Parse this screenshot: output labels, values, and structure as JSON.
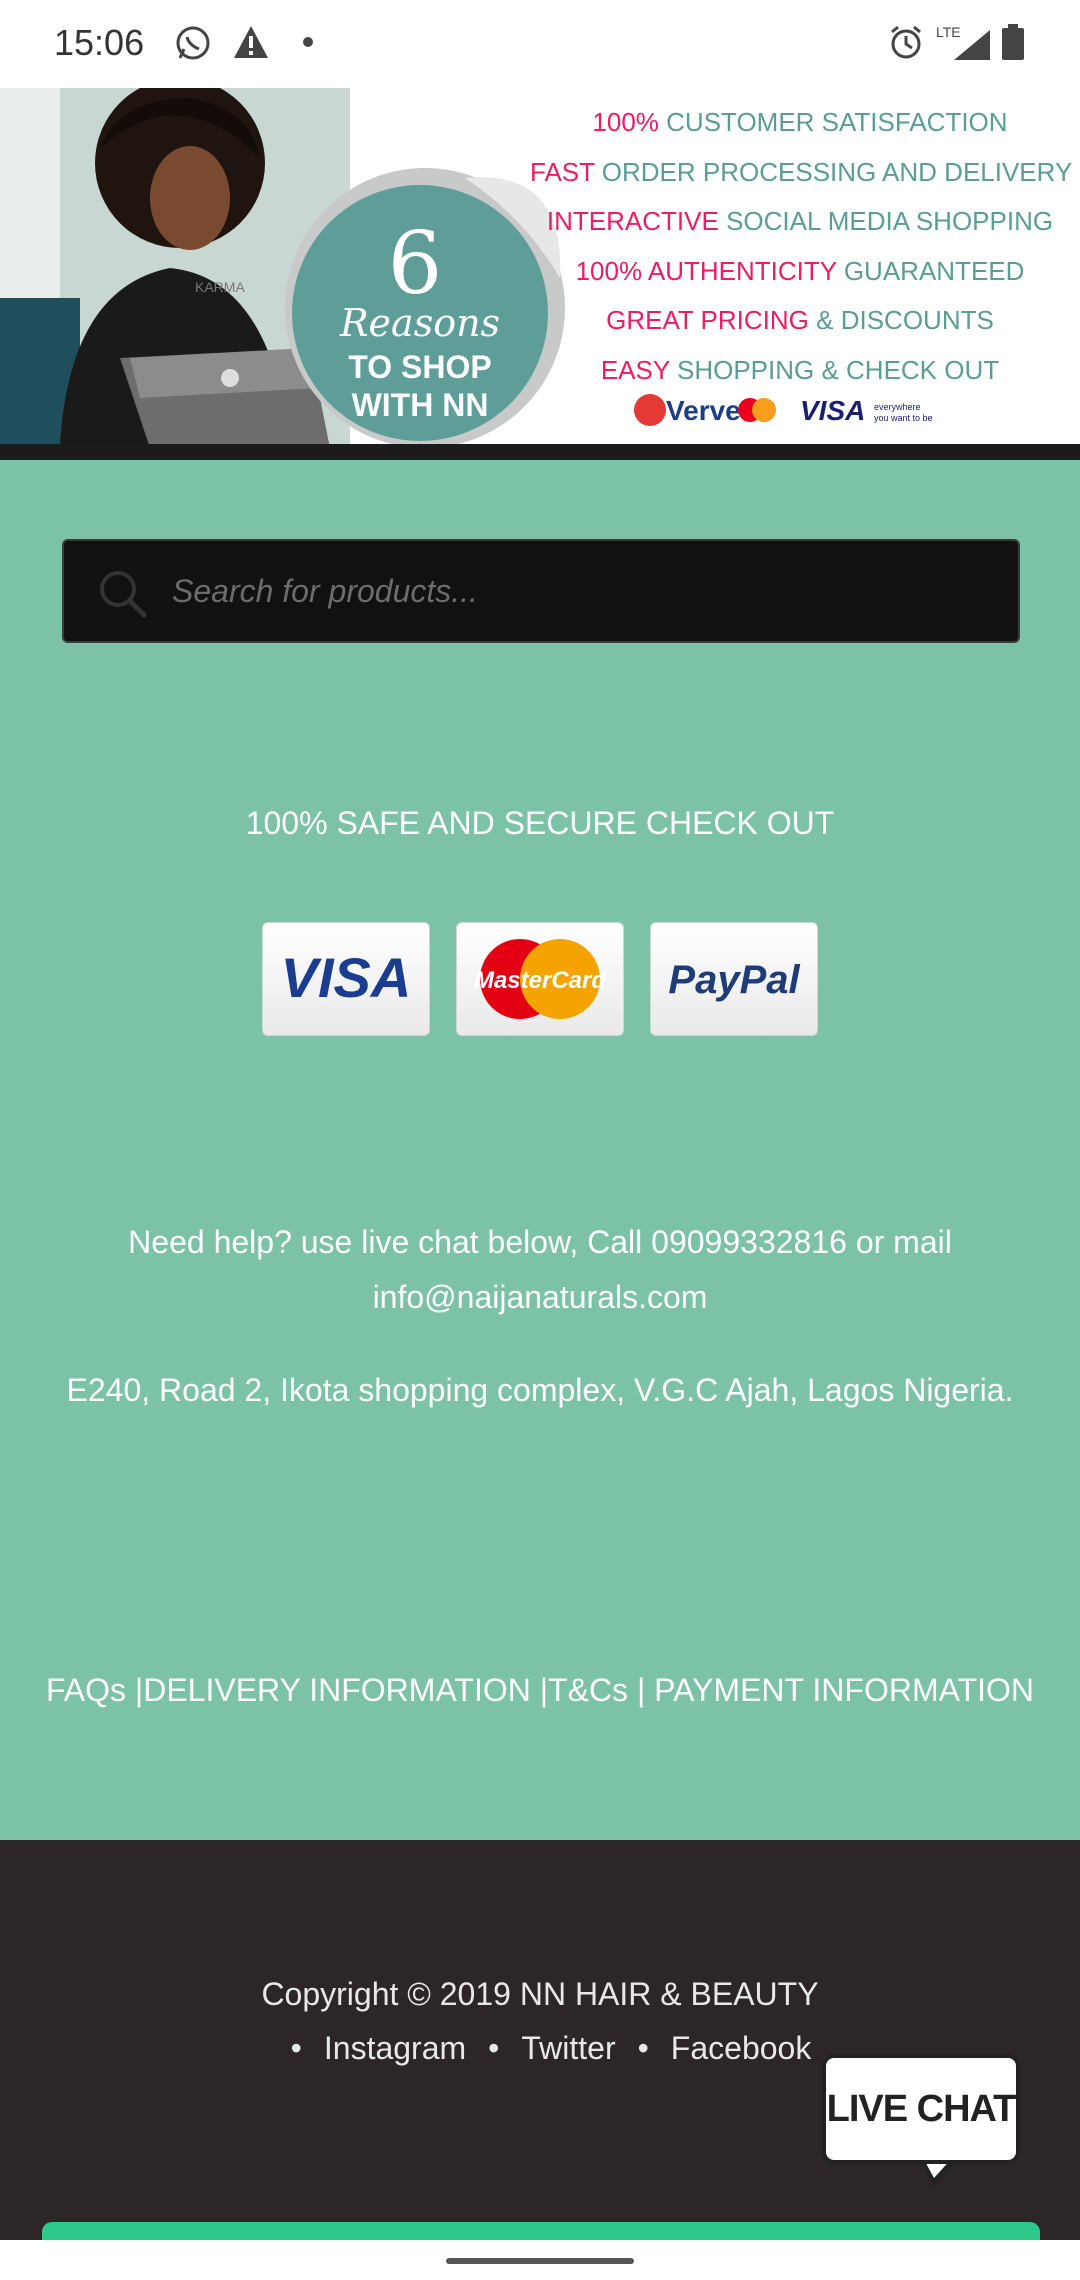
{
  "status_bar": {
    "time": "15:06",
    "network": "LTE",
    "icons": [
      "whatsapp-icon",
      "warning-icon",
      "dot-icon",
      "alarm-icon",
      "signal-icon",
      "battery-icon"
    ]
  },
  "banner": {
    "sticker_number": "6",
    "sticker_script": "Reasons",
    "sticker_line1": "TO SHOP",
    "sticker_line2": "WITH NN",
    "lines": [
      {
        "highlight": "100%",
        "rest": " CUSTOMER SATISFACTION"
      },
      {
        "highlight": "FAST",
        "rest": " ORDER PROCESSING AND DELIVERY"
      },
      {
        "highlight": "INTERACTIVE",
        "rest": " SOCIAL MEDIA SHOPPING"
      },
      {
        "highlight": "100% AUTHENTICITY",
        "rest": " GUARANTEED"
      },
      {
        "highlight": "GREAT PRICING",
        "rest": " & DISCOUNTS"
      },
      {
        "highlight": "EASY",
        "rest": " SHOPPING & CHECK OUT"
      }
    ],
    "payment_logos": [
      "Verve",
      "MasterCard",
      "VISA"
    ],
    "visa_tagline1": "everywhere",
    "visa_tagline2": "you want to be",
    "laptop_label": "KARMA"
  },
  "search": {
    "placeholder": "Search for products..."
  },
  "secure": {
    "title": "100% SAFE AND SECURE CHECK OUT",
    "cards": [
      "VISA",
      "MasterCard",
      "PayPal"
    ]
  },
  "contact": {
    "help_text": "Need help? use live chat below,  Call 09099332816 or mail info@naijanaturals.com",
    "address": "E240, Road 2, Ikota shopping complex, V.G.C Ajah, Lagos Nigeria."
  },
  "footer_links": [
    {
      "label": "FAQs",
      "sep": " |"
    },
    {
      "label": "DELIVERY INFORMATION",
      "sep": " |"
    },
    {
      "label": "T&Cs",
      "sep": " | "
    },
    {
      "label": "PAYMENT INFORMATION",
      "sep": ""
    }
  ],
  "footer": {
    "copyright": "Copyright © 2019 NN HAIR & BEAUTY",
    "social": [
      "Instagram",
      "Twitter",
      "Facebook"
    ],
    "bullet": "•"
  },
  "live_chat": {
    "label": "LIVE CHAT"
  },
  "colors": {
    "green": "#7cc2a6",
    "dark": "#2d2627",
    "accent_pink": "#e91e63",
    "teal_text": "#5a9d94"
  }
}
